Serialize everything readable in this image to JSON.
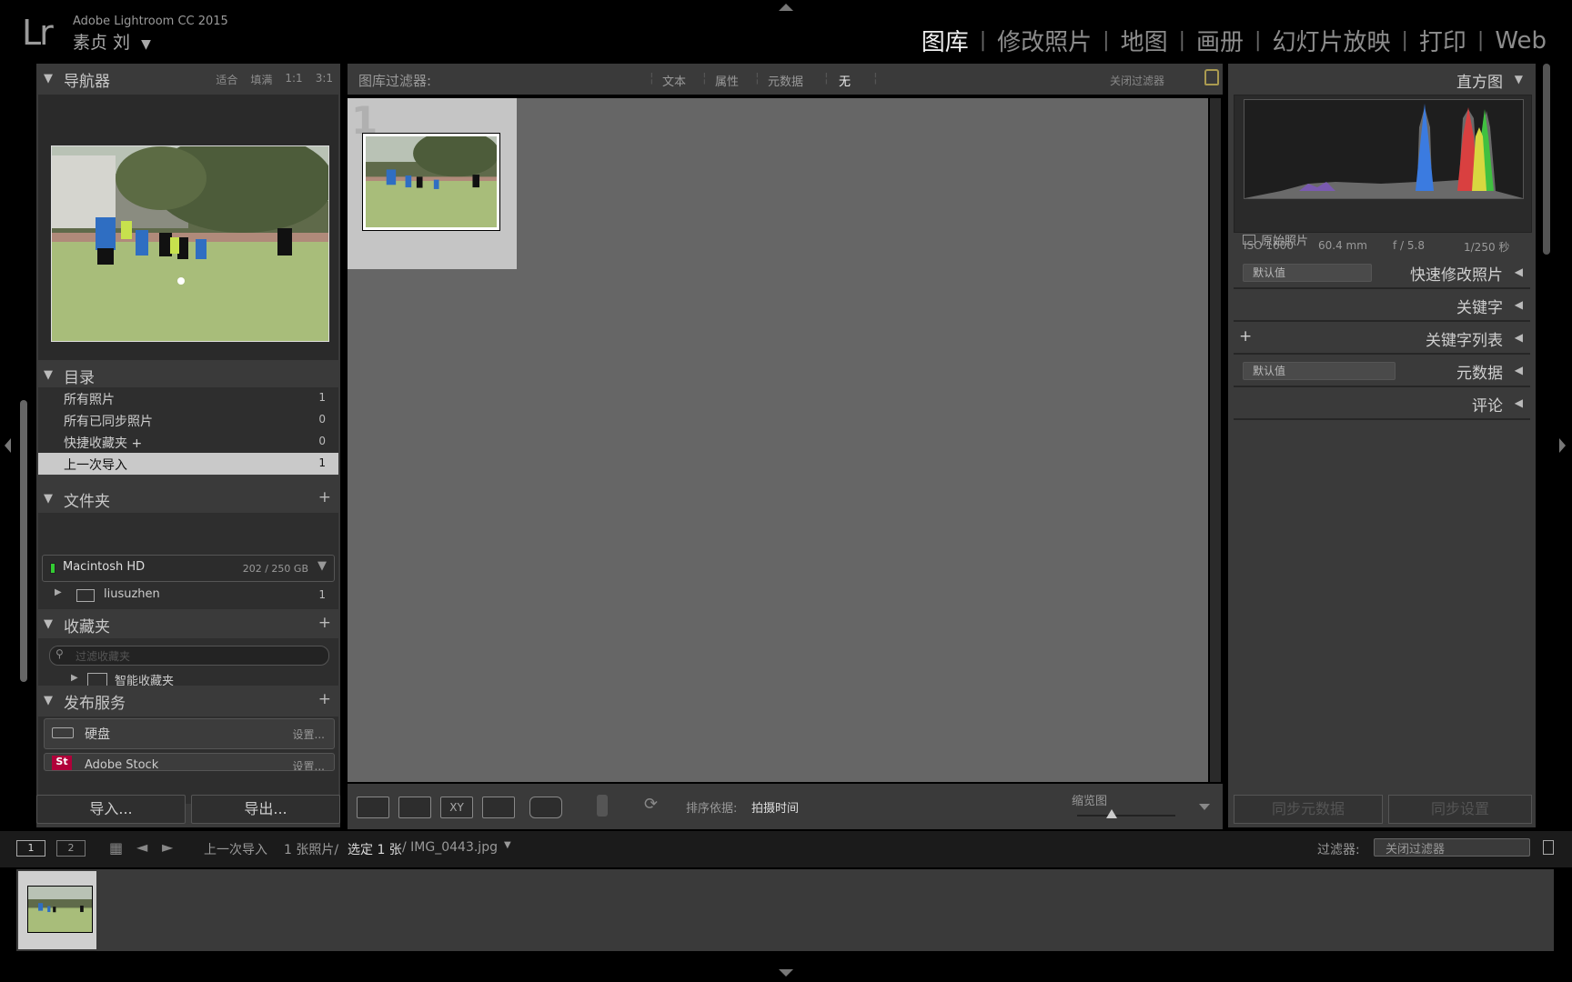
{
  "app": {
    "logo": "Lr",
    "title": "Adobe Lightroom CC 2015",
    "user": "素贞 刘",
    "user_arrow": "▼"
  },
  "modules": [
    {
      "label": "图库",
      "active": true
    },
    {
      "label": "修改照片"
    },
    {
      "label": "地图"
    },
    {
      "label": "画册"
    },
    {
      "label": "幻灯片放映"
    },
    {
      "label": "打印"
    },
    {
      "label": "Web"
    }
  ],
  "navigator": {
    "title": "导航器",
    "options": [
      "适合",
      "填满",
      "1:1",
      "3:1"
    ]
  },
  "catalog": {
    "title": "目录",
    "items": [
      {
        "label": "所有照片",
        "count": "1"
      },
      {
        "label": "所有已同步照片",
        "count": "0"
      },
      {
        "label": "快捷收藏夹 +",
        "count": "0"
      },
      {
        "label": "上一次导入",
        "count": "1"
      }
    ]
  },
  "folders": {
    "title": "文件夹",
    "disk_name": "Macintosh HD",
    "disk_usage": "202 / 250 GB",
    "folder": "liusuzhen",
    "folder_count": "1"
  },
  "collections": {
    "title": "收藏夹",
    "search_placeholder": "过滤收藏夹",
    "smart": "智能收藏夹"
  },
  "publish": {
    "title": "发布服务",
    "hd": "硬盘",
    "hd_setup": "设置...",
    "stock": "Adobe Stock",
    "stock_setup": "设置...",
    "stock_badge": "St"
  },
  "left_buttons": {
    "import": "导入...",
    "export": "导出..."
  },
  "filter_bar": {
    "label": "图库过滤器:",
    "text": "文本",
    "attr": "属性",
    "meta": "元数据",
    "none": "无",
    "close": "关闭过滤器"
  },
  "grid": {
    "cell_number": "1"
  },
  "toolbar": {
    "sort_label": "排序依据:",
    "sort_value": "拍摄时间",
    "thumb_label": "缩览图"
  },
  "histogram": {
    "title": "直方图",
    "iso": "ISO 1600",
    "focal": "60.4 mm",
    "aperture": "f / 5.8",
    "shutter": "1/250 秒",
    "original": "原始照片"
  },
  "right_panels": {
    "quick": "快速修改照片",
    "keywords": "关键字",
    "keyword_list": "关键字列表",
    "metadata": "元数据",
    "comments": "评论",
    "preset_default": "默认值",
    "plus": "+"
  },
  "right_buttons": {
    "sync_meta": "同步元数据",
    "sync_settings": "同步设置"
  },
  "filmstrip": {
    "screen1": "1",
    "screen2": "2",
    "source": "上一次导入",
    "count": "1 张照片/",
    "selected": "选定 1 张",
    "filename": "/ IMG_0443.jpg",
    "filter_label": "过滤器:",
    "filter_value": "关闭过滤器"
  }
}
